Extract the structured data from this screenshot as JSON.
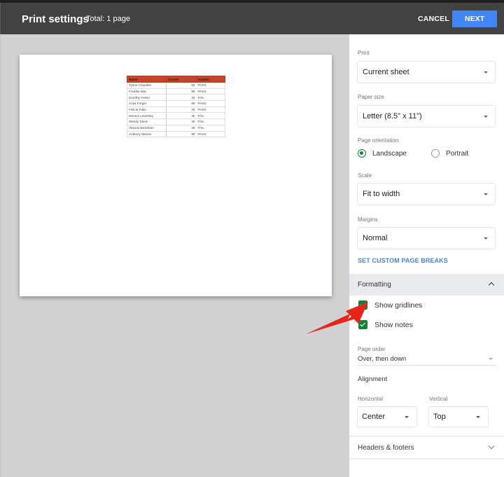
{
  "header": {
    "title": "Print settings",
    "total": "Total: 1 page",
    "cancel_label": "CANCEL",
    "next_label": "NEXT"
  },
  "colors": {
    "accent_blue": "#4285f4",
    "checkbox_green": "#188038",
    "sheet_header_red": "#c5442a",
    "link_blue": "#4a86d8",
    "annotation_arrow": "#e8231c"
  },
  "preview": {
    "table": {
      "columns": [
        "Name",
        "Scores",
        "Grades"
      ],
      "rows": [
        [
          "Tyson Chandler",
          "52",
          "PASS"
        ],
        [
          "Freddie Mac",
          "88",
          "PASS"
        ],
        [
          "Dorothy Fisher",
          "33",
          "FAIL"
        ],
        [
          "Anya Forger",
          "90",
          "PASS"
        ],
        [
          "Felicia Palin",
          "75",
          "PASS"
        ],
        [
          "Monica Lewinsky",
          "45",
          "FAIL"
        ],
        [
          "Wendy Davis",
          "40",
          "FAIL"
        ],
        [
          "Victoria Beckham",
          "29",
          "FAIL"
        ],
        [
          "Anthony Weiner",
          "89",
          "PASS"
        ]
      ]
    }
  },
  "panel": {
    "print": {
      "label": "Print",
      "value": "Current sheet"
    },
    "paper_size": {
      "label": "Paper size",
      "value": "Letter (8.5\" x 11\")"
    },
    "orientation": {
      "label": "Page orientation",
      "options": [
        {
          "label": "Landscape",
          "selected": true
        },
        {
          "label": "Portrait",
          "selected": false
        }
      ]
    },
    "scale": {
      "label": "Scale",
      "value": "Fit to width"
    },
    "margins": {
      "label": "Margins",
      "value": "Normal"
    },
    "custom_breaks_link": "SET CUSTOM PAGE BREAKS",
    "formatting": {
      "title": "Formatting",
      "expanded": true,
      "show_gridlines": {
        "label": "Show gridlines",
        "checked": true
      },
      "show_notes": {
        "label": "Show notes",
        "checked": true
      },
      "page_order": {
        "label": "Page order",
        "value": "Over, then down"
      },
      "alignment": {
        "title": "Alignment",
        "horizontal": {
          "label": "Horizontal",
          "value": "Center"
        },
        "vertical": {
          "label": "Vertical",
          "value": "Top"
        }
      }
    },
    "headers_footers": {
      "title": "Headers & footers",
      "expanded": false
    }
  }
}
